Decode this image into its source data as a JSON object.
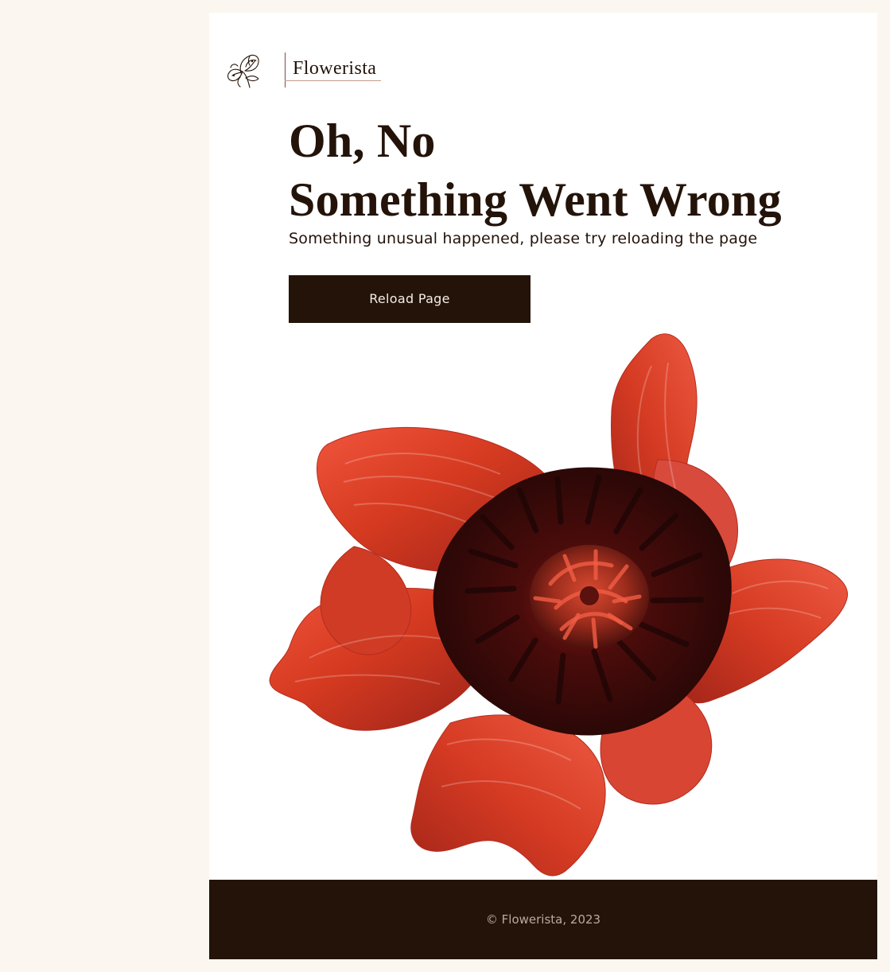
{
  "brand": {
    "name": "Flowerista",
    "icon": "flower-line-icon"
  },
  "error": {
    "title_line_1": "Oh, No",
    "title_line_2": "Something Went Wrong",
    "message": "Something unusual happened, please try reloading the page",
    "reload_label": "Reload Page"
  },
  "illustration": {
    "name": "red-poppy-flower-illustration"
  },
  "footer": {
    "copyright": "© Flowerista, 2023"
  },
  "colors": {
    "page_background": "#fbf6f0",
    "content_background": "#ffffff",
    "dark_brown": "#231309",
    "petal_red": "#d53a20",
    "petal_shadow": "#8f1f18",
    "flower_center": "#3a0d0b",
    "footer_text": "#b9aaa0"
  }
}
